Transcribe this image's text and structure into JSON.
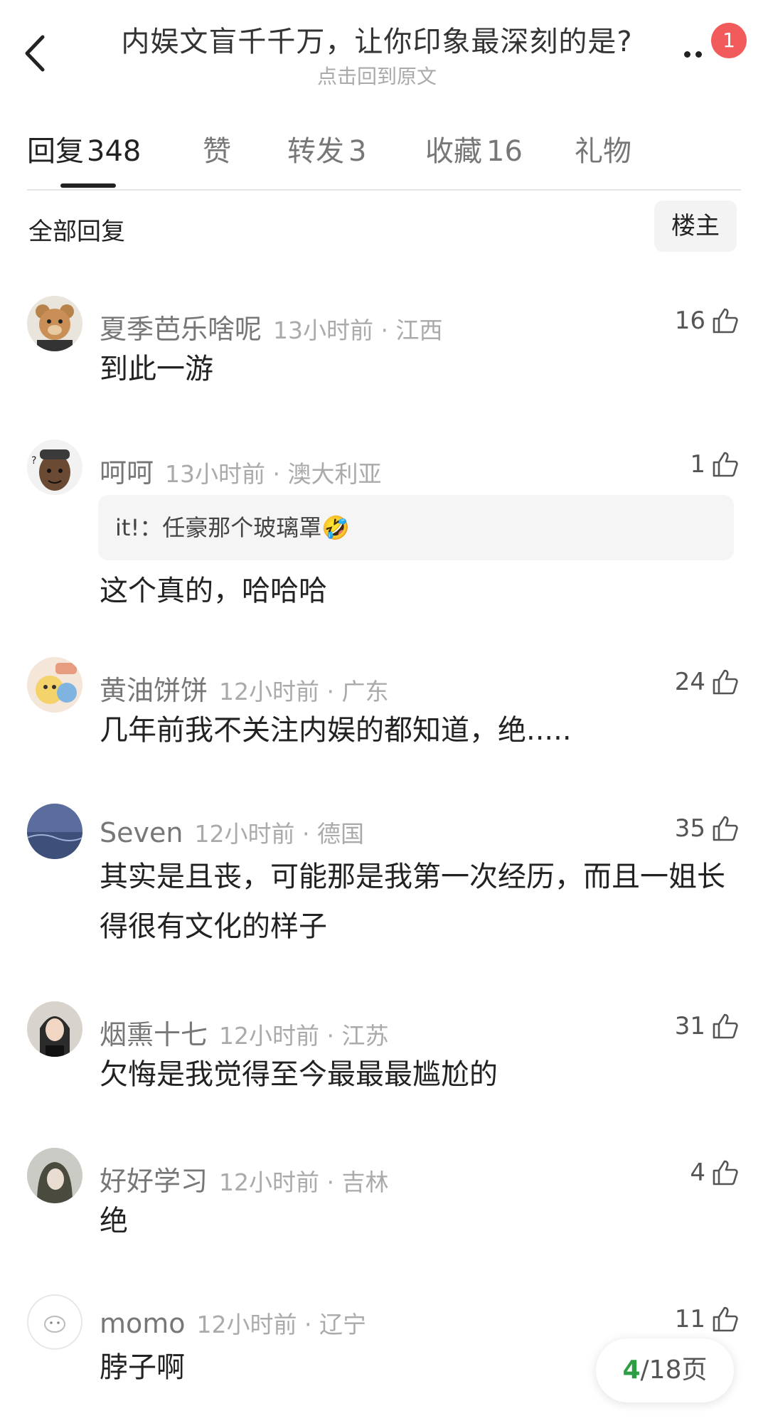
{
  "header": {
    "title": "内娱文盲千千万，让你印象最深刻的是?",
    "subtitle": "点击回到原文",
    "notification_count": "1"
  },
  "tabs": [
    {
      "label": "回复",
      "count": "348"
    },
    {
      "label": "赞",
      "count": ""
    },
    {
      "label": "转发",
      "count": "3"
    },
    {
      "label": "收藏",
      "count": "16"
    },
    {
      "label": "礼物",
      "count": ""
    }
  ],
  "filter": {
    "label": "全部回复",
    "op_button": "楼主"
  },
  "comments": [
    {
      "user": "夏季芭乐啥呢",
      "time": "13小时前",
      "location": "江西",
      "likes": "16",
      "text": "到此一游",
      "quote": ""
    },
    {
      "user": "呵呵",
      "time": "13小时前",
      "location": "澳大利亚",
      "likes": "1",
      "text": "这个真的，哈哈哈",
      "quote": "it!：任豪那个玻璃罩🤣"
    },
    {
      "user": "黄油饼饼",
      "time": "12小时前",
      "location": "广东",
      "likes": "24",
      "text": "几年前我不关注内娱的都知道，绝.....",
      "quote": ""
    },
    {
      "user": "Seven",
      "time": "12小时前",
      "location": "德国",
      "likes": "35",
      "text": "其实是且丧，可能那是我第一次经历，而且一姐长得很有文化的样子",
      "quote": ""
    },
    {
      "user": "烟熏十七",
      "time": "12小时前",
      "location": "江苏",
      "likes": "31",
      "text": "欠悔是我觉得至今最最最尴尬的",
      "quote": ""
    },
    {
      "user": "好好学习",
      "time": "12小时前",
      "location": "吉林",
      "likes": "4",
      "text": "绝",
      "quote": ""
    },
    {
      "user": "momo",
      "time": "12小时前",
      "location": "辽宁",
      "likes": "11",
      "text": "脖子啊",
      "quote": ""
    }
  ],
  "meta_separator": "·",
  "pager": {
    "current": "4",
    "total": "/18页"
  },
  "colors": {
    "badge": "#f25b5b",
    "pager_current": "#2e9e45"
  }
}
